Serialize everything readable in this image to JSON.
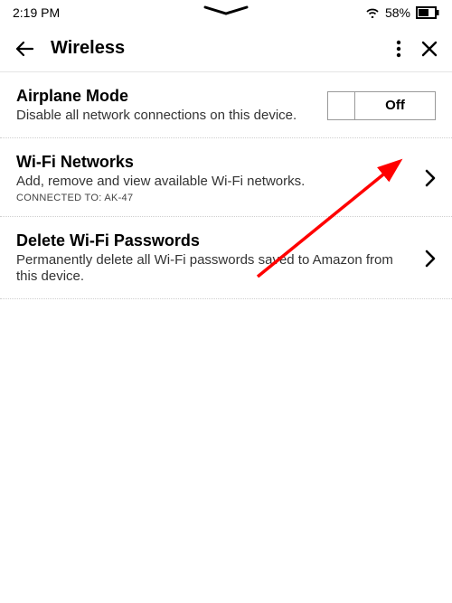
{
  "status": {
    "time": "2:19 PM",
    "battery_pct": "58%"
  },
  "nav": {
    "title": "Wireless"
  },
  "settings": {
    "airplane": {
      "title": "Airplane Mode",
      "desc": "Disable all network connections on this device.",
      "toggle_label": "Off"
    },
    "wifi": {
      "title": "Wi-Fi Networks",
      "desc": "Add, remove and view available Wi-Fi networks.",
      "connected_prefix": "CONNECTED TO: ",
      "connected_ssid": "AK-47"
    },
    "delete": {
      "title": "Delete Wi-Fi Passwords",
      "desc": "Permanently delete all Wi-Fi passwords saved to Amazon from this device."
    }
  }
}
